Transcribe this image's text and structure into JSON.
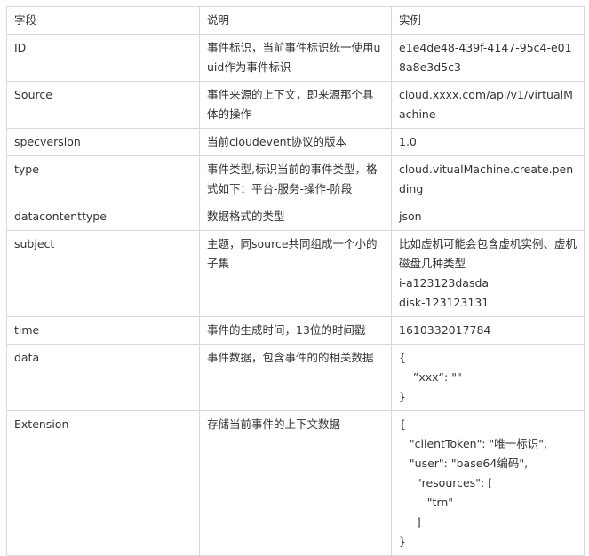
{
  "table": {
    "headers": [
      "字段",
      "说明",
      "实例"
    ],
    "rows": [
      {
        "field": "ID",
        "desc": "事件标识，当前事件标识统一使用uuid作为事件标识",
        "example": [
          "e1e4de48-439f-4147-95c4-e018a8e3d5c3"
        ]
      },
      {
        "field": "Source",
        "desc": "事件来源的上下文，即来源那个具体的操作",
        "example": [
          "cloud.xxxx.com/api/v1/virtualMachine"
        ]
      },
      {
        "field": "specversion",
        "desc": "当前cloudevent协议的版本",
        "example": [
          "1.0"
        ]
      },
      {
        "field": "type",
        "desc": "事件类型,标识当前的事件类型，格式如下：平台-服务-操作-阶段",
        "example": [
          "cloud.vitualMachine.create.pending"
        ]
      },
      {
        "field": "datacontenttype",
        "desc": "数据格式的类型",
        "example": [
          "json"
        ]
      },
      {
        "field": "subject",
        "desc": "主题，同source共同组成一个小的子集",
        "example": [
          "比如虚机可能会包含虚机实例、虚机磁盘几种类型",
          "i-a123123dasda",
          "disk-123123131"
        ]
      },
      {
        "field": "time",
        "desc": "事件的生成时间，13位的时间戳",
        "example": [
          "1610332017784"
        ]
      },
      {
        "field": "data",
        "desc": "事件数据，包含事件的的相关数据",
        "example": [
          "{",
          "    ”xxx“: \"\"",
          "}"
        ]
      },
      {
        "field": "Extension",
        "desc": "存储当前事件的上下文数据",
        "example": [
          "{",
          "   \"clientToken\": \"唯一标识\",",
          "   \"user\": \"base64编码\",",
          "     \"resources\": [",
          "        \"trn\"",
          "     ]",
          "}"
        ]
      }
    ]
  }
}
